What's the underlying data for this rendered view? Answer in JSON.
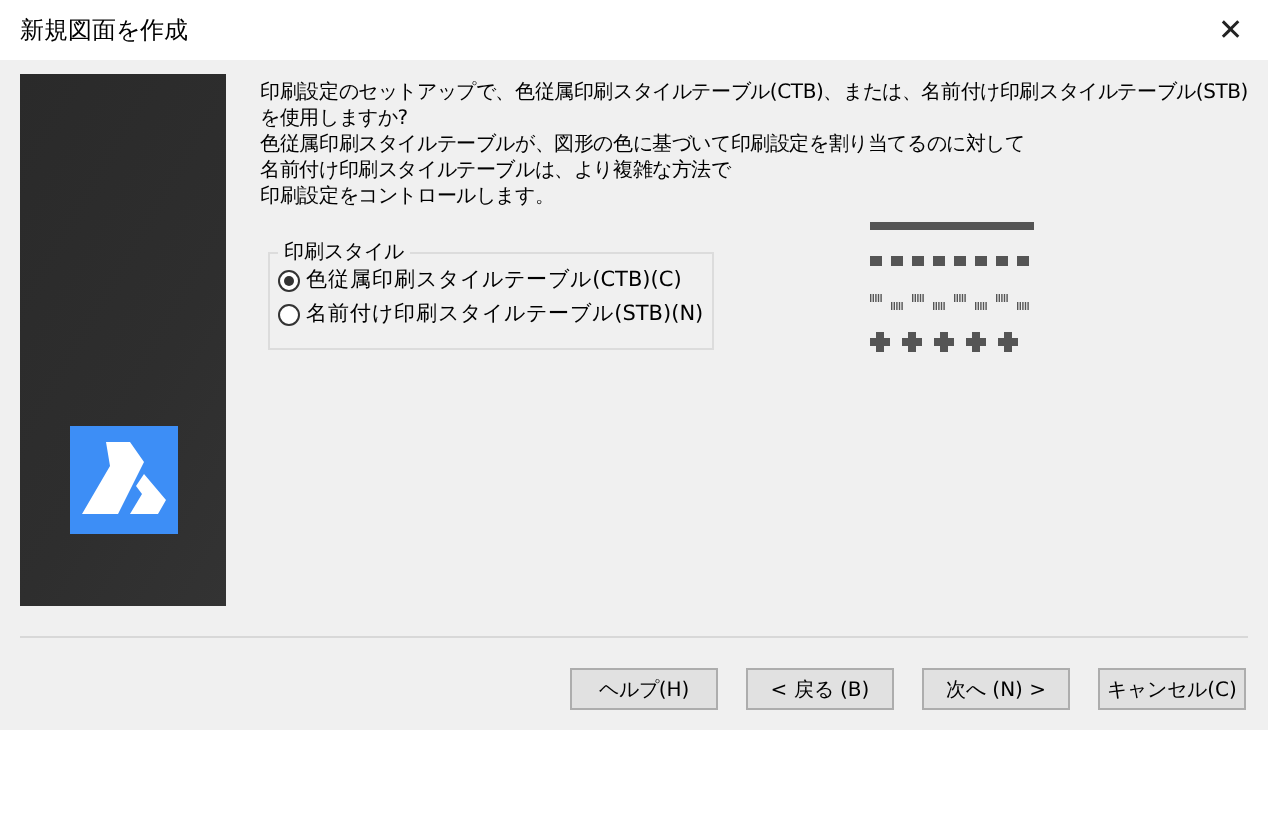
{
  "window": {
    "title": "新規図面を作成",
    "close": "✕"
  },
  "intro_lines": [
    "印刷設定のセットアップで、色従属印刷スタイルテーブル(CTB)、または、名前付け印刷スタイルテーブル(STB)",
    "を使用しますか?",
    "色従属印刷スタイルテーブルが、図形の色に基づいて印刷設定を割り当てるのに対して",
    "名前付け印刷スタイルテーブルは、より複雑な方法で",
    "印刷設定をコントロールします。"
  ],
  "print_style": {
    "label": "印刷スタイル",
    "options": [
      {
        "label": "色従属印刷スタイルテーブル(CTB)(C)",
        "selected": true
      },
      {
        "label": "名前付け印刷スタイルテーブル(STB)(N)",
        "selected": false
      }
    ]
  },
  "buttons": [
    "ヘルプ(H)",
    "< 戻る (B)",
    "次へ (N) >",
    "キャンセル(C)"
  ]
}
